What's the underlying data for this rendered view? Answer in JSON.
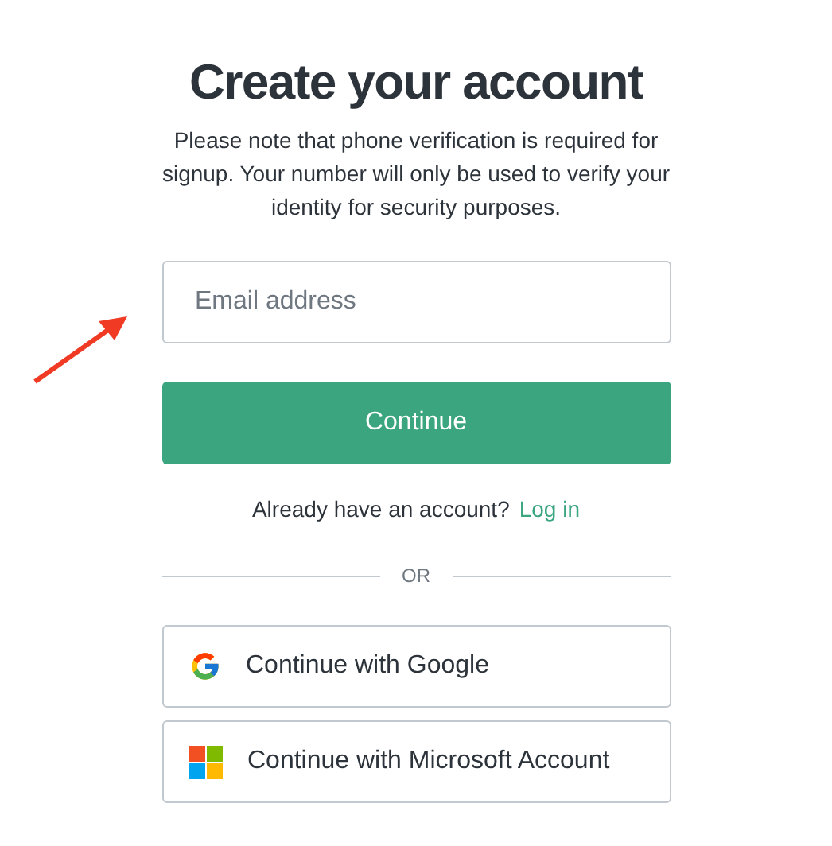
{
  "title": "Create your account",
  "note": "Please note that phone verification is required for signup. Your number will only be used to verify your identity for security purposes.",
  "email_field": {
    "placeholder": "Email address"
  },
  "continue_button": "Continue",
  "login_prompt": {
    "text": "Already have an account?",
    "link": "Log in"
  },
  "divider": "OR",
  "social_buttons": [
    {
      "kind": "google",
      "label": "Continue with Google"
    },
    {
      "kind": "microsoft",
      "label": "Continue with Microsoft Account"
    }
  ]
}
